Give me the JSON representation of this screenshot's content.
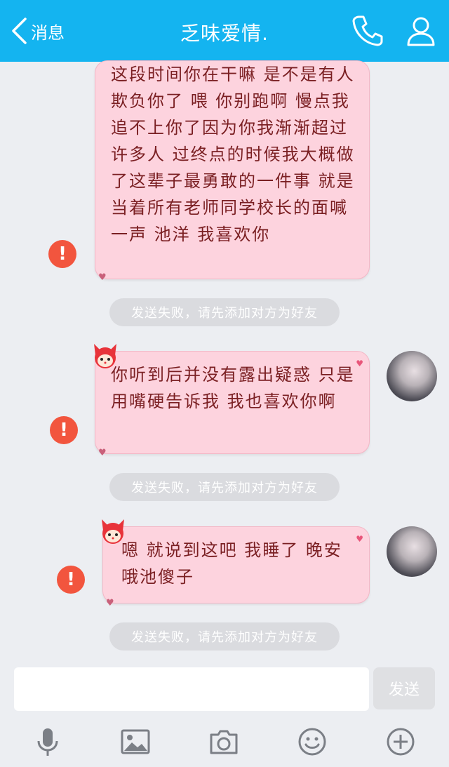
{
  "header": {
    "back_label": "消息",
    "title": "乏味爱情.",
    "icons": [
      "phone-icon",
      "profile-icon"
    ]
  },
  "messages": [
    {
      "text": "这段时间你在干嘛 是不是有人欺负你了 喂 你别跑啊 慢点我追不上你了因为你我渐渐超过许多人 过终点的时候我大概做了这辈子最勇敢的一件事 就是当着所有老师同学校长的面喊一声 池洋 我喜欢你",
      "status": "failed"
    },
    {
      "text": "你听到后并没有露出疑惑 只是用嘴硬告诉我 我也喜欢你啊",
      "status": "failed"
    },
    {
      "text": "嗯 就说到这吧 我睡了 晚安哦池傻子",
      "status": "failed"
    }
  ],
  "notices": {
    "send_failed": "发送失败，请先添加对方为好友"
  },
  "composer": {
    "placeholder": "",
    "send_label": "发送"
  },
  "toolbar": [
    "microphone-icon",
    "image-icon",
    "camera-icon",
    "emoji-icon",
    "plus-icon"
  ],
  "colors": {
    "header_bg": "#14b4f0",
    "bubble_bg": "#fdd3de",
    "bubble_text": "#7a1f22",
    "error_red": "#f2553e",
    "notice_bg": "#dadbdf"
  }
}
